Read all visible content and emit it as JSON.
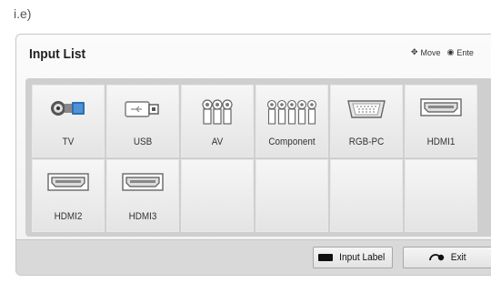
{
  "caption": "i.e)",
  "panel": {
    "title": "Input List",
    "hints": {
      "move": "Move",
      "enter": "Ente"
    }
  },
  "inputs": [
    {
      "label": "TV",
      "icon": "antenna-icon"
    },
    {
      "label": "USB",
      "icon": "usb-icon"
    },
    {
      "label": "AV",
      "icon": "av-icon"
    },
    {
      "label": "Component",
      "icon": "component-icon"
    },
    {
      "label": "RGB-PC",
      "icon": "rgb-pc-icon"
    },
    {
      "label": "HDMI1",
      "icon": "hdmi-icon"
    },
    {
      "label": "HDMI2",
      "icon": "hdmi-icon"
    },
    {
      "label": "HDMI3",
      "icon": "hdmi-icon"
    }
  ],
  "footer": {
    "input_label_button": "Input Label",
    "exit_button": "Exit"
  },
  "colors": {
    "panel_bg": "#f3f3f3",
    "grid_bg": "#cfcfcf",
    "footer_bg": "#d9d9d9"
  }
}
